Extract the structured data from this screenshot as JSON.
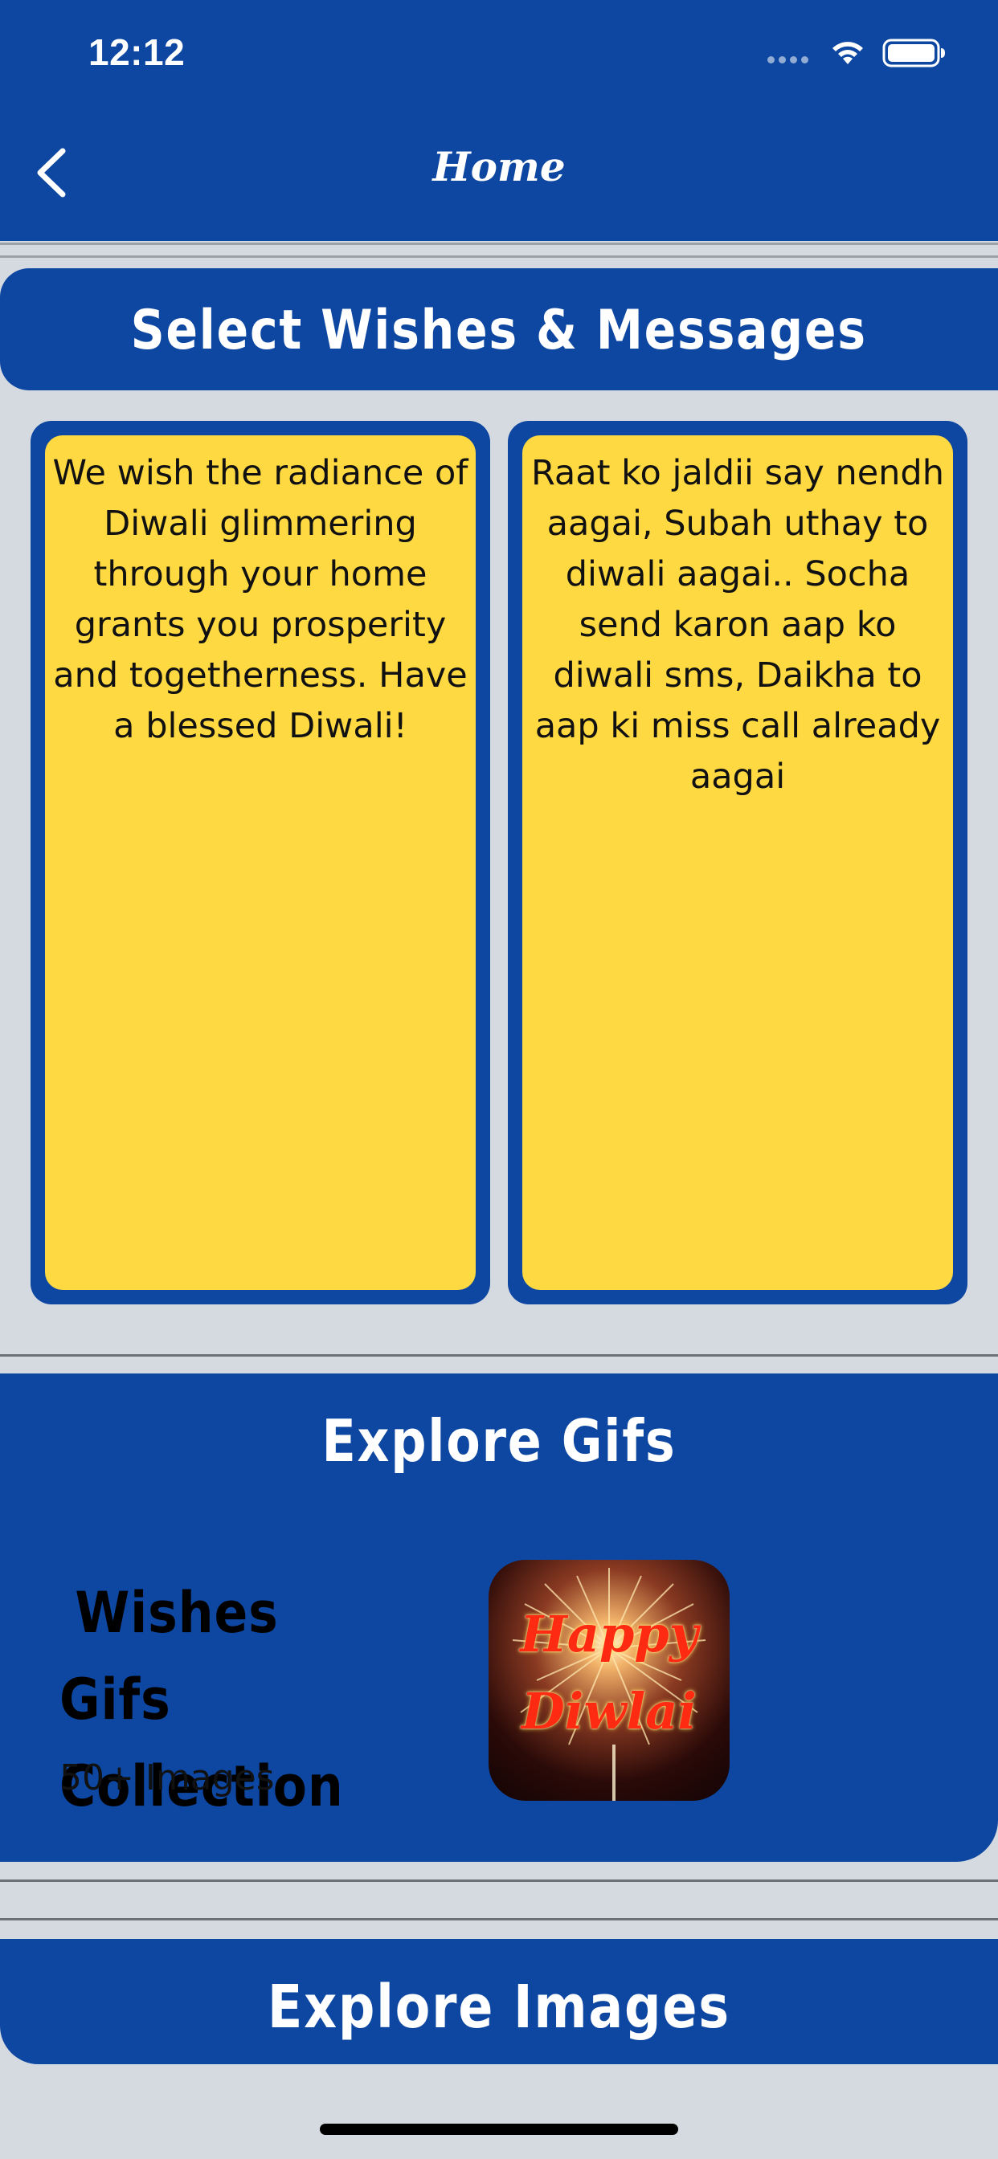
{
  "status_bar": {
    "time": "12:12"
  },
  "nav": {
    "title": "Home",
    "back_icon": "chevron-left-icon"
  },
  "wishes": {
    "header": "Select Wishes & Messages",
    "cards": [
      "We wish the radiance of Diwali glimmering through your home grants you prosperity and togetherness. Have a blessed Diwali!",
      "Raat ko jaldii say nendh aagai, Subah uthay to diwali aagai.. Socha send karon aap ko diwali sms, Daikha to aap ki miss call already aagai"
    ]
  },
  "gifs": {
    "header": "Explore Gifs",
    "heading_line1": "Wishes",
    "heading_line2": "Gifs Collection",
    "count": "50+ Images",
    "thumb_line1": "Happy",
    "thumb_line2": "Diwlai"
  },
  "images": {
    "header": "Explore Images"
  },
  "colors": {
    "primary": "#0e47a1",
    "card": "#fed941",
    "background": "#d4dae0"
  }
}
